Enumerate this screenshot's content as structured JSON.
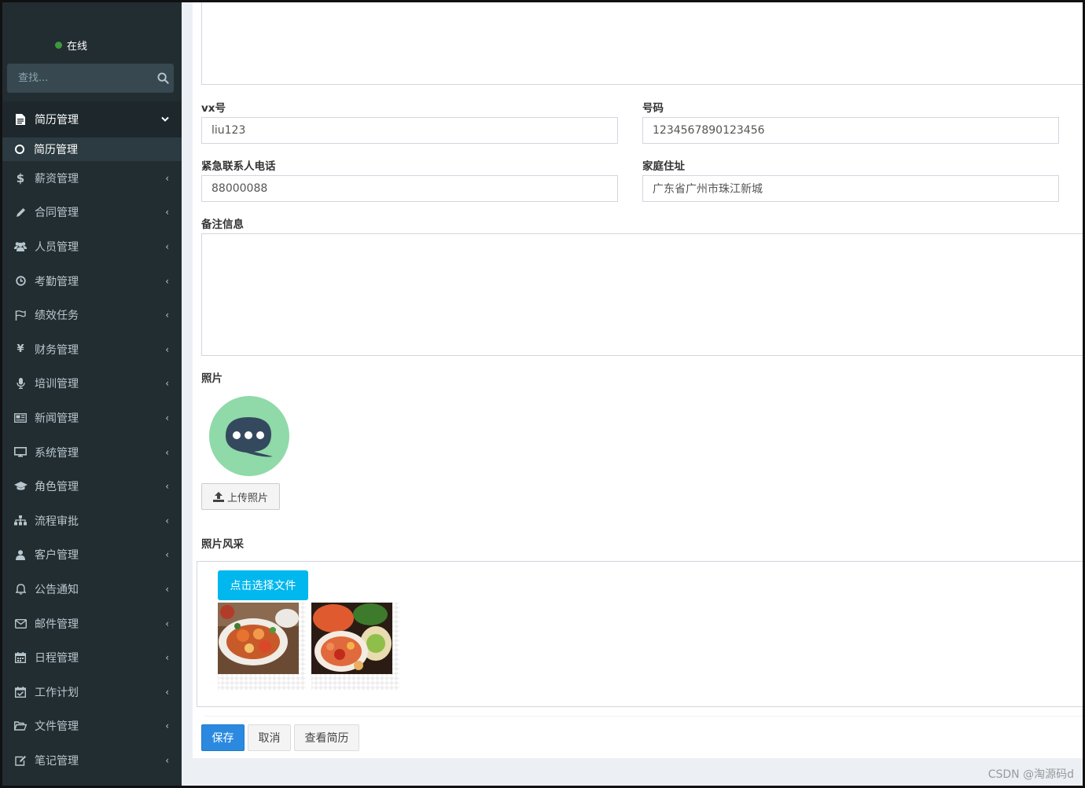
{
  "sidebar": {
    "status_label": "在线",
    "search_placeholder": "查找...",
    "items": [
      {
        "label": "简历管理",
        "icon": "file-icon"
      },
      {
        "label": "薪资管理",
        "icon": "dollar-icon"
      },
      {
        "label": "合同管理",
        "icon": "pencil-icon"
      },
      {
        "label": "人员管理",
        "icon": "users-icon"
      },
      {
        "label": "考勤管理",
        "icon": "clock-icon"
      },
      {
        "label": "绩效任务",
        "icon": "flag-icon"
      },
      {
        "label": "财务管理",
        "icon": "yen-icon"
      },
      {
        "label": "培训管理",
        "icon": "microphone-icon"
      },
      {
        "label": "新闻管理",
        "icon": "newspaper-icon"
      },
      {
        "label": "系统管理",
        "icon": "monitor-icon"
      },
      {
        "label": "角色管理",
        "icon": "graduation-cap-icon"
      },
      {
        "label": "流程审批",
        "icon": "sitemap-icon"
      },
      {
        "label": "客户管理",
        "icon": "user-icon"
      },
      {
        "label": "公告通知",
        "icon": "bell-icon"
      },
      {
        "label": "邮件管理",
        "icon": "envelope-icon"
      },
      {
        "label": "日程管理",
        "icon": "calendar-icon"
      },
      {
        "label": "工作计划",
        "icon": "calendar-check-icon"
      },
      {
        "label": "文件管理",
        "icon": "folder-open-icon"
      },
      {
        "label": "笔记管理",
        "icon": "edit-icon"
      }
    ],
    "submenu_label": "简历管理"
  },
  "form": {
    "wechat_label": "vx号",
    "wechat_value": "liu123",
    "phone_label": "号码",
    "phone_value": "1234567890123456",
    "emergency_label": "紧急联系人电话",
    "emergency_value": "88000088",
    "address_label": "家庭住址",
    "address_value": "广东省广州市珠江新城",
    "remark_label": "备注信息",
    "photo_label": "照片",
    "upload_label": "上传照片",
    "gallery_label": "照片风采",
    "choose_file_label": "点击选择文件"
  },
  "actions": {
    "save": "保存",
    "cancel": "取消",
    "view_resume": "查看简历"
  },
  "colors": {
    "sidebar_bg": "#222d32",
    "primary": "#2b8ae0",
    "upload_accent": "#00b7ee",
    "avatar_bg": "#8fdaa8",
    "avatar_bubble": "#34495e"
  },
  "watermark": "CSDN @淘源码d"
}
